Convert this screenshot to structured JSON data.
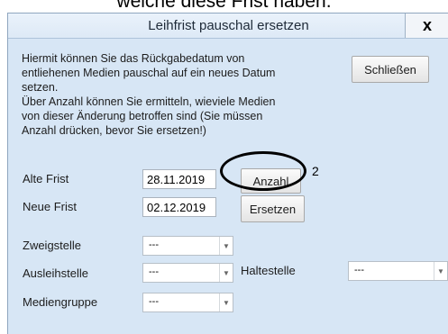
{
  "caption": "welche diese Frist haben.",
  "dialog": {
    "title": "Leihfrist pauschal ersetzen",
    "close_label": "x",
    "description": "Hiermit können Sie das Rückgabedatum von\nentliehenen Medien pauschal auf ein neues Datum\nsetzen.\nÜber Anzahl können Sie ermitteln, wieviele Medien\nvon dieser Änderung betroffen sind (Sie müssen\nAnzahl drücken, bevor Sie ersetzen!)",
    "close_button": "Schließen",
    "alte_frist_label": "Alte Frist",
    "alte_frist_value": "28.11.2019",
    "anzahl_button": "Anzahl",
    "annotation_number": "2",
    "neue_frist_label": "Neue Frist",
    "neue_frist_value": "02.12.2019",
    "ersetzen_button": "Ersetzen",
    "zweigstelle_label": "Zweigstelle",
    "zweigstelle_value": "---",
    "ausleihstelle_label": "Ausleihstelle",
    "ausleihstelle_value": "---",
    "haltestelle_label": "Haltestelle",
    "haltestelle_value": "---",
    "mediengruppe_label": "Mediengruppe",
    "mediengruppe_value": "---",
    "icons": {
      "close": "close-icon",
      "dropdown": "chevron-down-icon"
    }
  }
}
